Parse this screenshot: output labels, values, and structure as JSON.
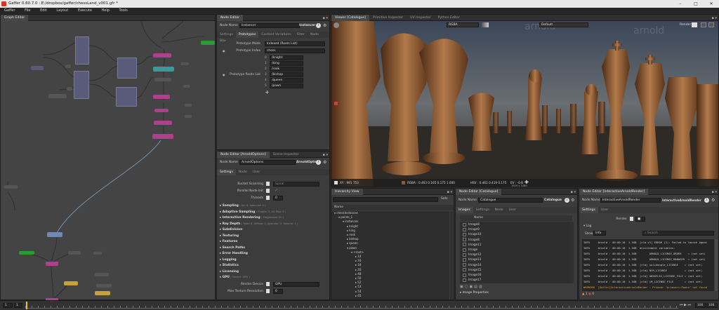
{
  "window": {
    "title": "Gaffer 0.60.7.0 : E:/dropbox/gaffer/chessLand_v001.gfr *",
    "min": "–",
    "max": "□",
    "close": "✕"
  },
  "menu": [
    "Gaffer",
    "File",
    "Edit",
    "Layout",
    "Execute",
    "Help",
    "Tools"
  ],
  "graph_editor": {
    "tab": "Graph Editor"
  },
  "node_editor_top": {
    "tab": "Node Editor",
    "node_name_label": "Node Name",
    "node_name": "Instancer",
    "node_type": "Instancer",
    "tabs": [
      "Settings",
      "Prototypes",
      "Context Variations",
      "Filter",
      "Node",
      "Box"
    ],
    "active_tab": "Prototypes",
    "prototype_mode_label": "Prototype Mode",
    "prototype_mode": "Indexed (Roots List)",
    "prototype_index_label": "Prototype Index",
    "prototype_index": "chess",
    "prototype_roots_label": "Prototype Roots List",
    "roots": [
      {
        "i": "0",
        "v": "/knight"
      },
      {
        "i": "1",
        "v": "/king"
      },
      {
        "i": "2",
        "v": "/rook"
      },
      {
        "i": "3",
        "v": "/bishop"
      },
      {
        "i": "4",
        "v": "/queen"
      },
      {
        "i": "5",
        "v": "/pawn"
      }
    ],
    "add": "+"
  },
  "arnold_options": {
    "tabs": [
      "Node Editor [ArnoldOptions]",
      "Scene Inspector"
    ],
    "node_name_label": "Node Name",
    "node_name": "ArnoldOptions",
    "node_type": "ArnoldOptions",
    "subtabs": [
      "Settings",
      "Node",
      "User"
    ],
    "bucket_scanning_label": "Bucket Scanning",
    "bucket_scanning": "Spiral",
    "parallel_node_init_label": "Parallel Node Init",
    "threads_label": "Threads",
    "threads": "0",
    "sections": [
      {
        "name": "Sampling",
        "note": "( AA: 6, Specular: 4 )"
      },
      {
        "name": "Adaptive Sampling",
        "note": "( Enable: 0, AA Max: 8 )"
      },
      {
        "name": "Interactive Rendering",
        "note": "( Progressive On )"
      },
      {
        "name": "Ray Depth",
        "note": "( Total: 8, Diffuse: 2, Specular: 2, Volume: 2 )"
      },
      {
        "name": "Subdivision",
        "note": ""
      },
      {
        "name": "Texturing",
        "note": ""
      },
      {
        "name": "Features",
        "note": ""
      },
      {
        "name": "Search Paths",
        "note": ""
      },
      {
        "name": "Error Handling",
        "note": ""
      },
      {
        "name": "Logging",
        "note": ""
      },
      {
        "name": "Statistics",
        "note": ""
      },
      {
        "name": "Licensing",
        "note": ""
      },
      {
        "name": "GPU",
        "note": "( Device: GPU )"
      }
    ],
    "render_device_label": "Render Device",
    "render_device": "GPU",
    "max_texture_label": "Max Texture Resolution",
    "max_texture": "0"
  },
  "viewer": {
    "tabs": [
      "Viewer [Catalogue]",
      "Primitive Inspector",
      "UV Inspector",
      "Python Editor"
    ],
    "channels": "RGBA",
    "display": "Default",
    "render_label": "Render",
    "watermark": "arnold",
    "status": {
      "xy": "XY : 991 753",
      "rgba": "RGBA : 0.463 0.165 0.175 1.000",
      "hsv": "HSV : 0.461 0.419 0.175",
      "ev": "EV : -0.8",
      "res": "1920 x 1080"
    }
  },
  "hierarchy": {
    "tab": "Hierarchy View",
    "filter": "",
    "set": "Sets",
    "col": "Name",
    "rows": [
      {
        "d": 0,
        "t": "▾ chessInstances"
      },
      {
        "d": 1,
        "t": "▾ points_1"
      },
      {
        "d": 2,
        "t": "▾ instances"
      },
      {
        "d": 3,
        "t": "▸ knight"
      },
      {
        "d": 3,
        "t": "▸ king"
      },
      {
        "d": 3,
        "t": "▸ rook"
      },
      {
        "d": 3,
        "t": "▸ bishop"
      },
      {
        "d": 3,
        "t": "▸ queen"
      },
      {
        "d": 3,
        "t": "▾ pawn"
      },
      {
        "d": 4,
        "t": "▾ <root>"
      },
      {
        "d": 5,
        "t": "▸ 14"
      },
      {
        "d": 5,
        "t": "▸ 16"
      },
      {
        "d": 5,
        "t": "▸ 18"
      },
      {
        "d": 5,
        "t": "▸ 20"
      },
      {
        "d": 5,
        "t": "▸ 48"
      },
      {
        "d": 5,
        "t": "▸ 50"
      },
      {
        "d": 5,
        "t": "▸ 52"
      },
      {
        "d": 5,
        "t": "▸ 53"
      },
      {
        "d": 5,
        "t": "▸ 54"
      },
      {
        "d": 5,
        "t": "▸ 65"
      }
    ]
  },
  "catalogue": {
    "tab": "Node Editor [Catalogue]",
    "node_name_label": "Node Name",
    "node_name": "Catalogue",
    "node_type": "Catalogue",
    "subtabs": [
      "Images",
      "Settings",
      "Node",
      "User"
    ],
    "col": "Name",
    "images": [
      "Image8",
      "Image9",
      "Image10",
      "Image8",
      "Image11",
      "Image",
      "Image12",
      "Image13",
      "Image14",
      "Image15",
      "Image16",
      "Image17"
    ],
    "image_props": "Image Properties"
  },
  "interactive": {
    "tab": "Node Editor [InteractiveArnoldRender]",
    "node_name_label": "Node Name",
    "node_name": "InteractiveArnoldRender",
    "node_type": "InteractiveArnoldRender",
    "subtabs": [
      "Settings",
      "User"
    ],
    "render_label": "Render",
    "log_label": "Log",
    "show_label": "Show",
    "show_value": "Info",
    "search_placeholder": "Search",
    "logs": [
      "INFO     Arnold : 00:00:10  1.5GB  [clm.v1] ERROR (2): Failed to launch Agent",
      "INFO     Arnold : 00:00:10  1.5GB  environment variables:",
      "INFO     Arnold : 00:00:10  1.5GB        ARNOLD_LICENSE_ORDER    = (not set)",
      "INFO     Arnold : 00:00:10  1.5GB        ARNOLD_LICENSE_MANAGER  = (not set)",
      "INFO     Arnold : 00:00:10  1.5GB  [rlm] solidangle_LICENSE    = (not set)",
      "INFO     Arnold : 00:00:10  1.5GB  [rlm] RLM_LICENSE           = (not set)",
      "INFO     Arnold : 00:00:10  1.5GB  [clm] ADSKFLEX_LICENSE_FILE = (not set)",
      "INFO     Arnold : 00:00:10  1.5GB  [clm] LM_LICENSE_FILE       = (not set)",
      "WARNING  [Gaffer]InteractiveArnoldRender : Primvar \"primvars:Pawns\" not found"
    ],
    "counts": {
      "w": "1",
      "e": "0"
    }
  },
  "timeline": {
    "start": "1",
    "frame": "1",
    "end": "100",
    "end2": "100"
  }
}
